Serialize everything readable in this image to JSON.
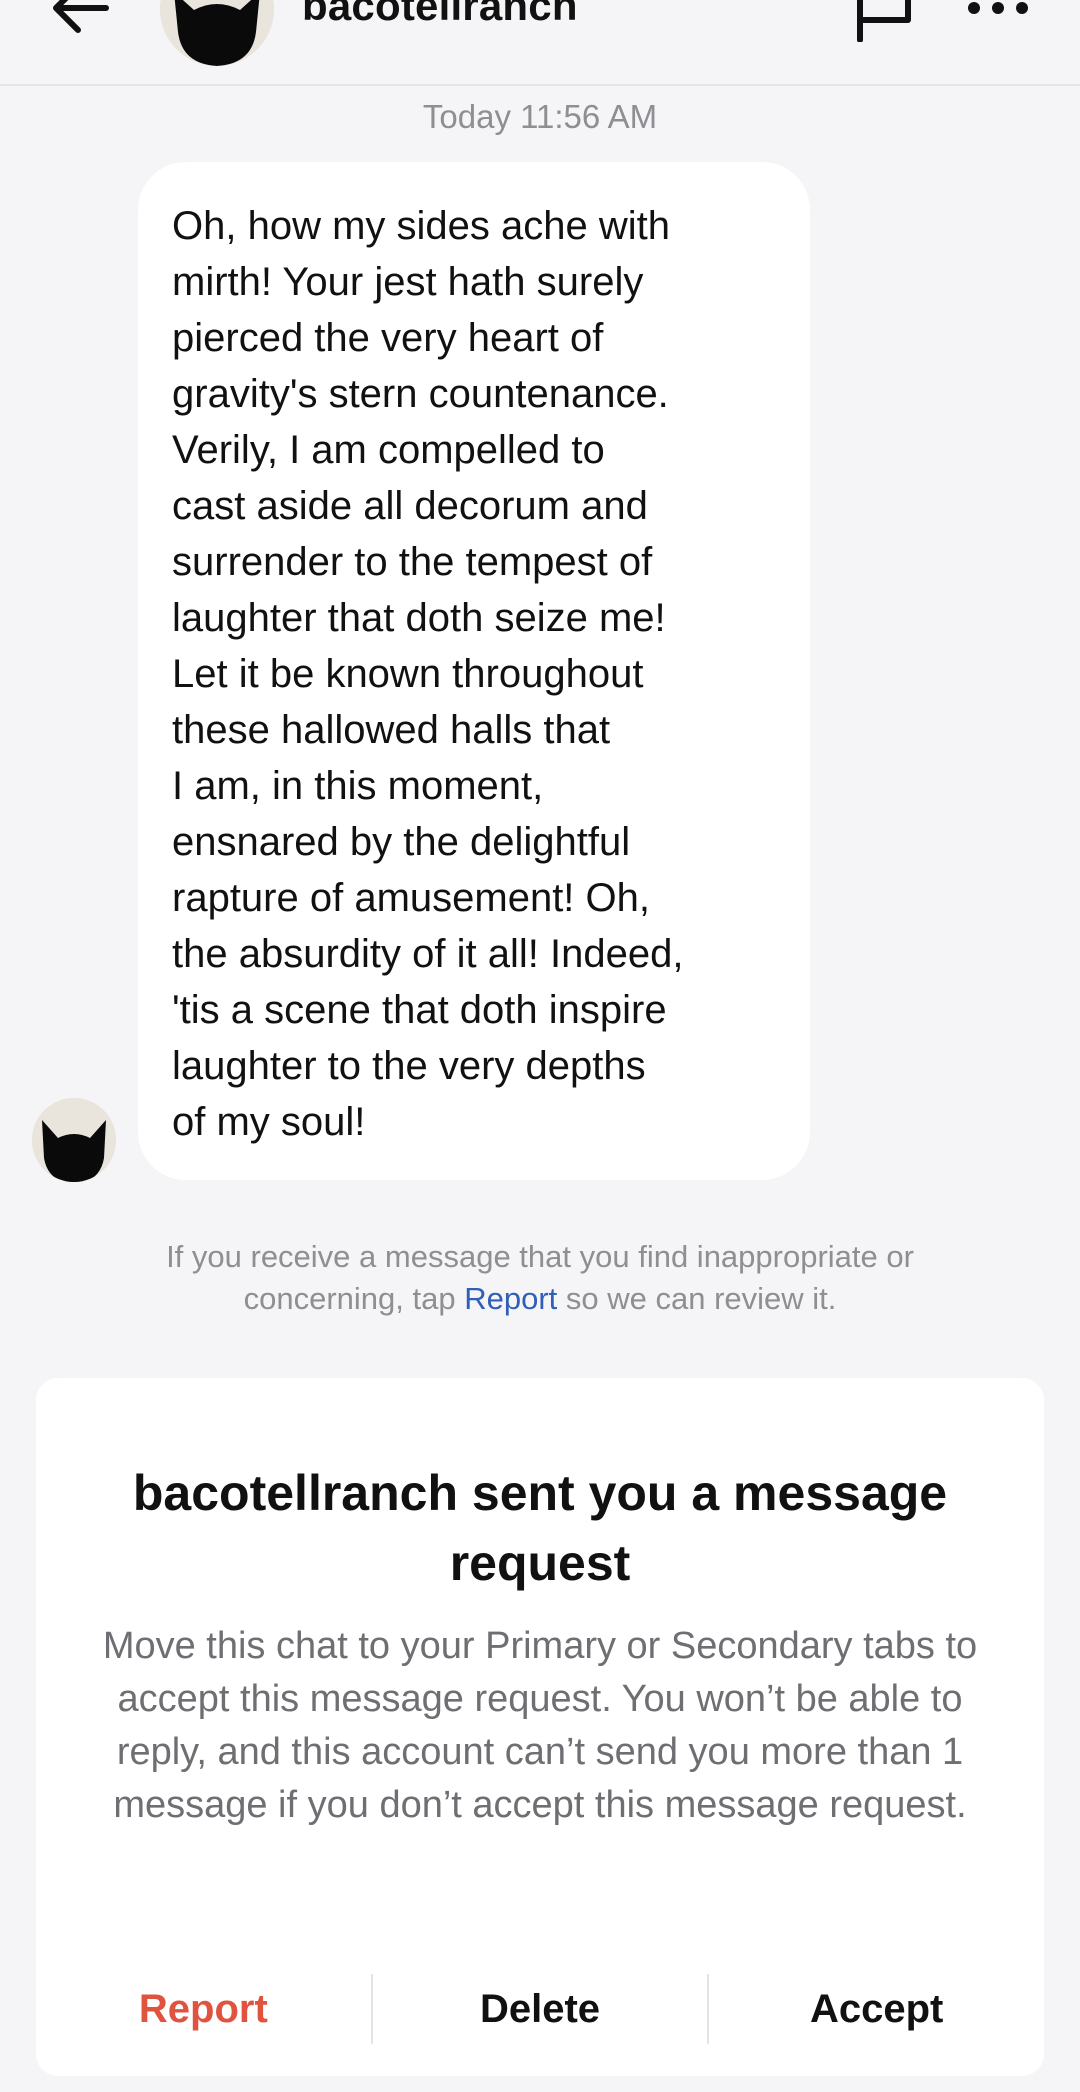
{
  "header": {
    "username": "bacotellranch"
  },
  "conversation": {
    "timestamp": "Today 11:56 AM",
    "message": "Oh, how my sides ache with\nmirth! Your jest hath surely\npierced the very heart of\ngravity's stern countenance.\nVerily, I am compelled to\ncast aside all decorum and\nsurrender to the tempest of\nlaughter that doth seize me!\nLet it be known throughout\nthese hallowed halls that\nI am, in this moment,\nensnared by the delightful\nrapture of amusement! Oh,\nthe absurdity of it all! Indeed,\n'tis a scene that doth inspire\nlaughter to the very depths\nof my soul!"
  },
  "notice": {
    "before": "If you receive a message that you find inappropriate or concerning, tap ",
    "link": "Report",
    "after": " so we can review it."
  },
  "request_card": {
    "title": "bacotellranch sent you a message request",
    "body": "Move this chat to your Primary or Secondary tabs to accept this message request. You won’t be able to reply, and this account can’t send you more than 1 message if you don’t accept this message request.",
    "actions": {
      "report": "Report",
      "delete": "Delete",
      "accept": "Accept"
    }
  },
  "colors": {
    "background": "#f5f5f7",
    "bubble": "#ffffff",
    "link": "#2f5fb8",
    "report": "#e0533f",
    "muted": "#8e8e93"
  },
  "icons": {
    "back": "arrow-left-icon",
    "flag": "flag-icon",
    "more": "more-horizontal-icon",
    "avatar": "black-cat-avatar"
  }
}
